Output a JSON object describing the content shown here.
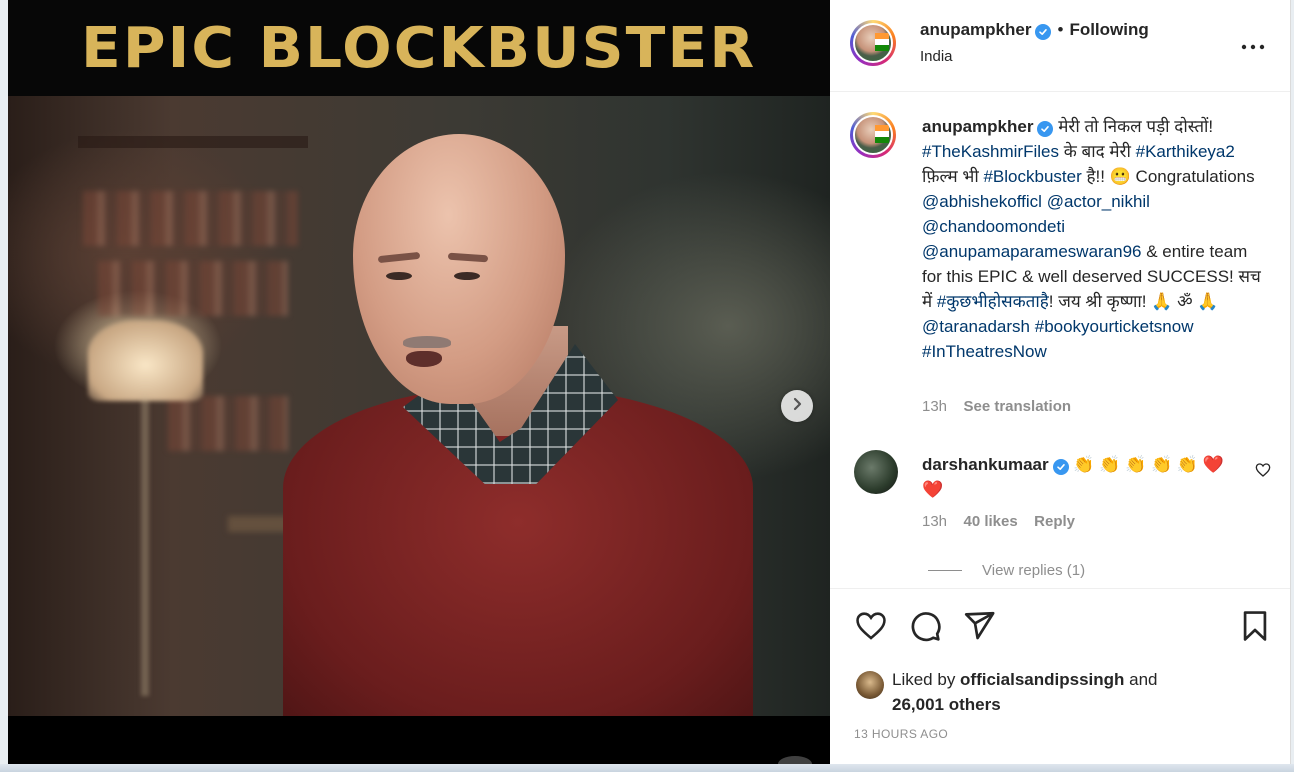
{
  "media": {
    "banner_text": "EPIC BLOCKBUSTER"
  },
  "header": {
    "username": "anupampkher",
    "separator": "•",
    "follow_label": "Following",
    "location": "India"
  },
  "caption": {
    "username": "anupampkher",
    "segments": [
      {
        "text": " मेरी तो निकल पड़ी दोस्तों! ",
        "type": "text"
      },
      {
        "text": "#TheKashmirFiles",
        "type": "tag"
      },
      {
        "text": " के बाद मेरी ",
        "type": "text"
      },
      {
        "text": "#Karthikeya2",
        "type": "tag"
      },
      {
        "text": " फ़िल्म भी ",
        "type": "text"
      },
      {
        "text": "#Blockbuster",
        "type": "tag"
      },
      {
        "text": " है!! 😬 Congratulations ",
        "type": "text"
      },
      {
        "text": "@abhishekofficl",
        "type": "tag"
      },
      {
        "text": " ",
        "type": "text"
      },
      {
        "text": "@actor_nikhil",
        "type": "tag"
      },
      {
        "text": " ",
        "type": "text"
      },
      {
        "text": "@chandoomondeti",
        "type": "tag"
      },
      {
        "text": " ",
        "type": "text"
      },
      {
        "text": "@anupamaparameswaran96",
        "type": "tag"
      },
      {
        "text": " & entire team for this EPIC & well deserved SUCCESS! सच में ",
        "type": "text"
      },
      {
        "text": "#कुछभीहोसकताहै",
        "type": "tag"
      },
      {
        "text": "! जय श्री कृष्णा! 🙏 ॐ 🙏  ",
        "type": "text"
      },
      {
        "text": "@taranadarsh",
        "type": "tag"
      },
      {
        "text": " ",
        "type": "text"
      },
      {
        "text": "#bookyourticketsnow",
        "type": "tag"
      },
      {
        "text": " ",
        "type": "text"
      },
      {
        "text": "#InTheatresNow",
        "type": "tag"
      }
    ],
    "time": "13h",
    "see_translation": "See translation"
  },
  "comment": {
    "username": "darshankumaar",
    "text": " 👏 👏 👏 👏 👏 ❤️ ❤️",
    "time": "13h",
    "likes": "40 likes",
    "reply": "Reply",
    "view_replies": "View replies (1)"
  },
  "actions": {
    "liked_by_prefix": "Liked by ",
    "liked_by_user": "officialsandipssingh",
    "liked_by_and": " and",
    "others": "26,001 others",
    "time_ago": "13 HOURS AGO"
  },
  "icons": [
    "chevron-right-icon",
    "more-icon",
    "verified-icon",
    "heart-icon",
    "comment-icon",
    "share-icon",
    "bookmark-icon"
  ],
  "colors": {
    "banner_gold": "#d8b45a",
    "link": "#00376b",
    "verified": "#3897f0",
    "secondary_text": "#8e8e8e"
  }
}
